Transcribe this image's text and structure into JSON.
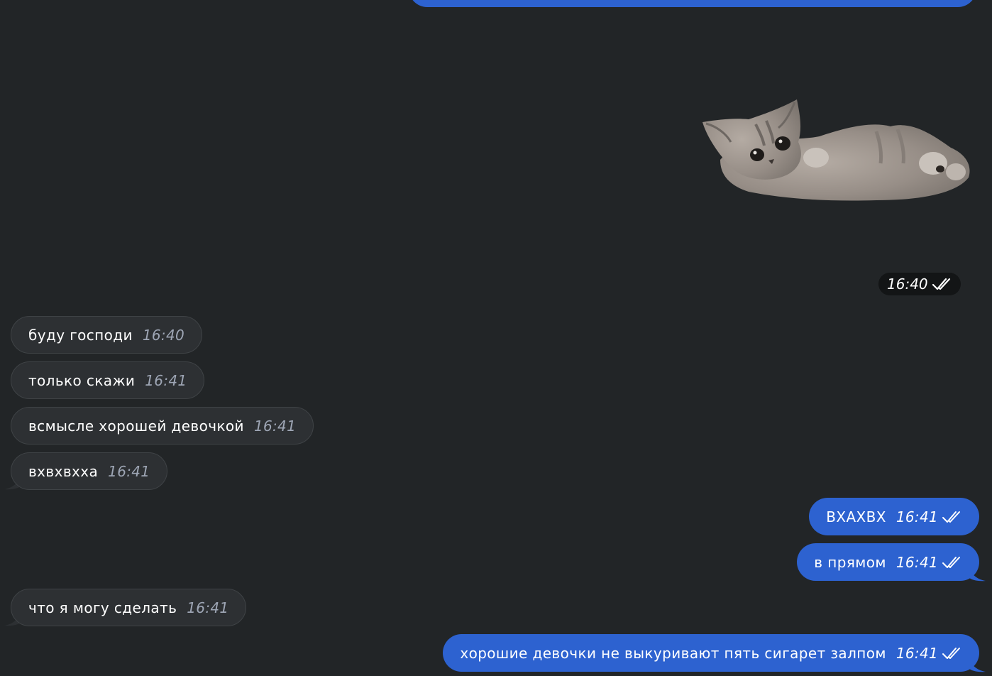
{
  "colors": {
    "background": "#222527",
    "incoming_bubble": "#2d3033",
    "outgoing_bubble": "#2d62d0",
    "incoming_time": "#9ea6b5",
    "sticker_time_bg": "#131516"
  },
  "sticker": {
    "icon": "kitten-sticker",
    "time": "16:40",
    "status_icon": "double-check-icon"
  },
  "messages": [
    {
      "direction": "in",
      "text": "буду господи",
      "time": "16:40"
    },
    {
      "direction": "in",
      "text": "только скажи",
      "time": "16:41"
    },
    {
      "direction": "in",
      "text": "всмысле хорошей девочкой",
      "time": "16:41"
    },
    {
      "direction": "in",
      "text": "вхвхвхха",
      "time": "16:41"
    },
    {
      "direction": "out",
      "text": "ВХАХВХ",
      "time": "16:41"
    },
    {
      "direction": "out",
      "text": "в прямом",
      "time": "16:41"
    },
    {
      "direction": "in",
      "text": "что я могу сделать",
      "time": "16:41"
    },
    {
      "direction": "out",
      "text": "хорошие девочки не выкуривают пять сигарет залпом",
      "time": "16:41"
    }
  ]
}
